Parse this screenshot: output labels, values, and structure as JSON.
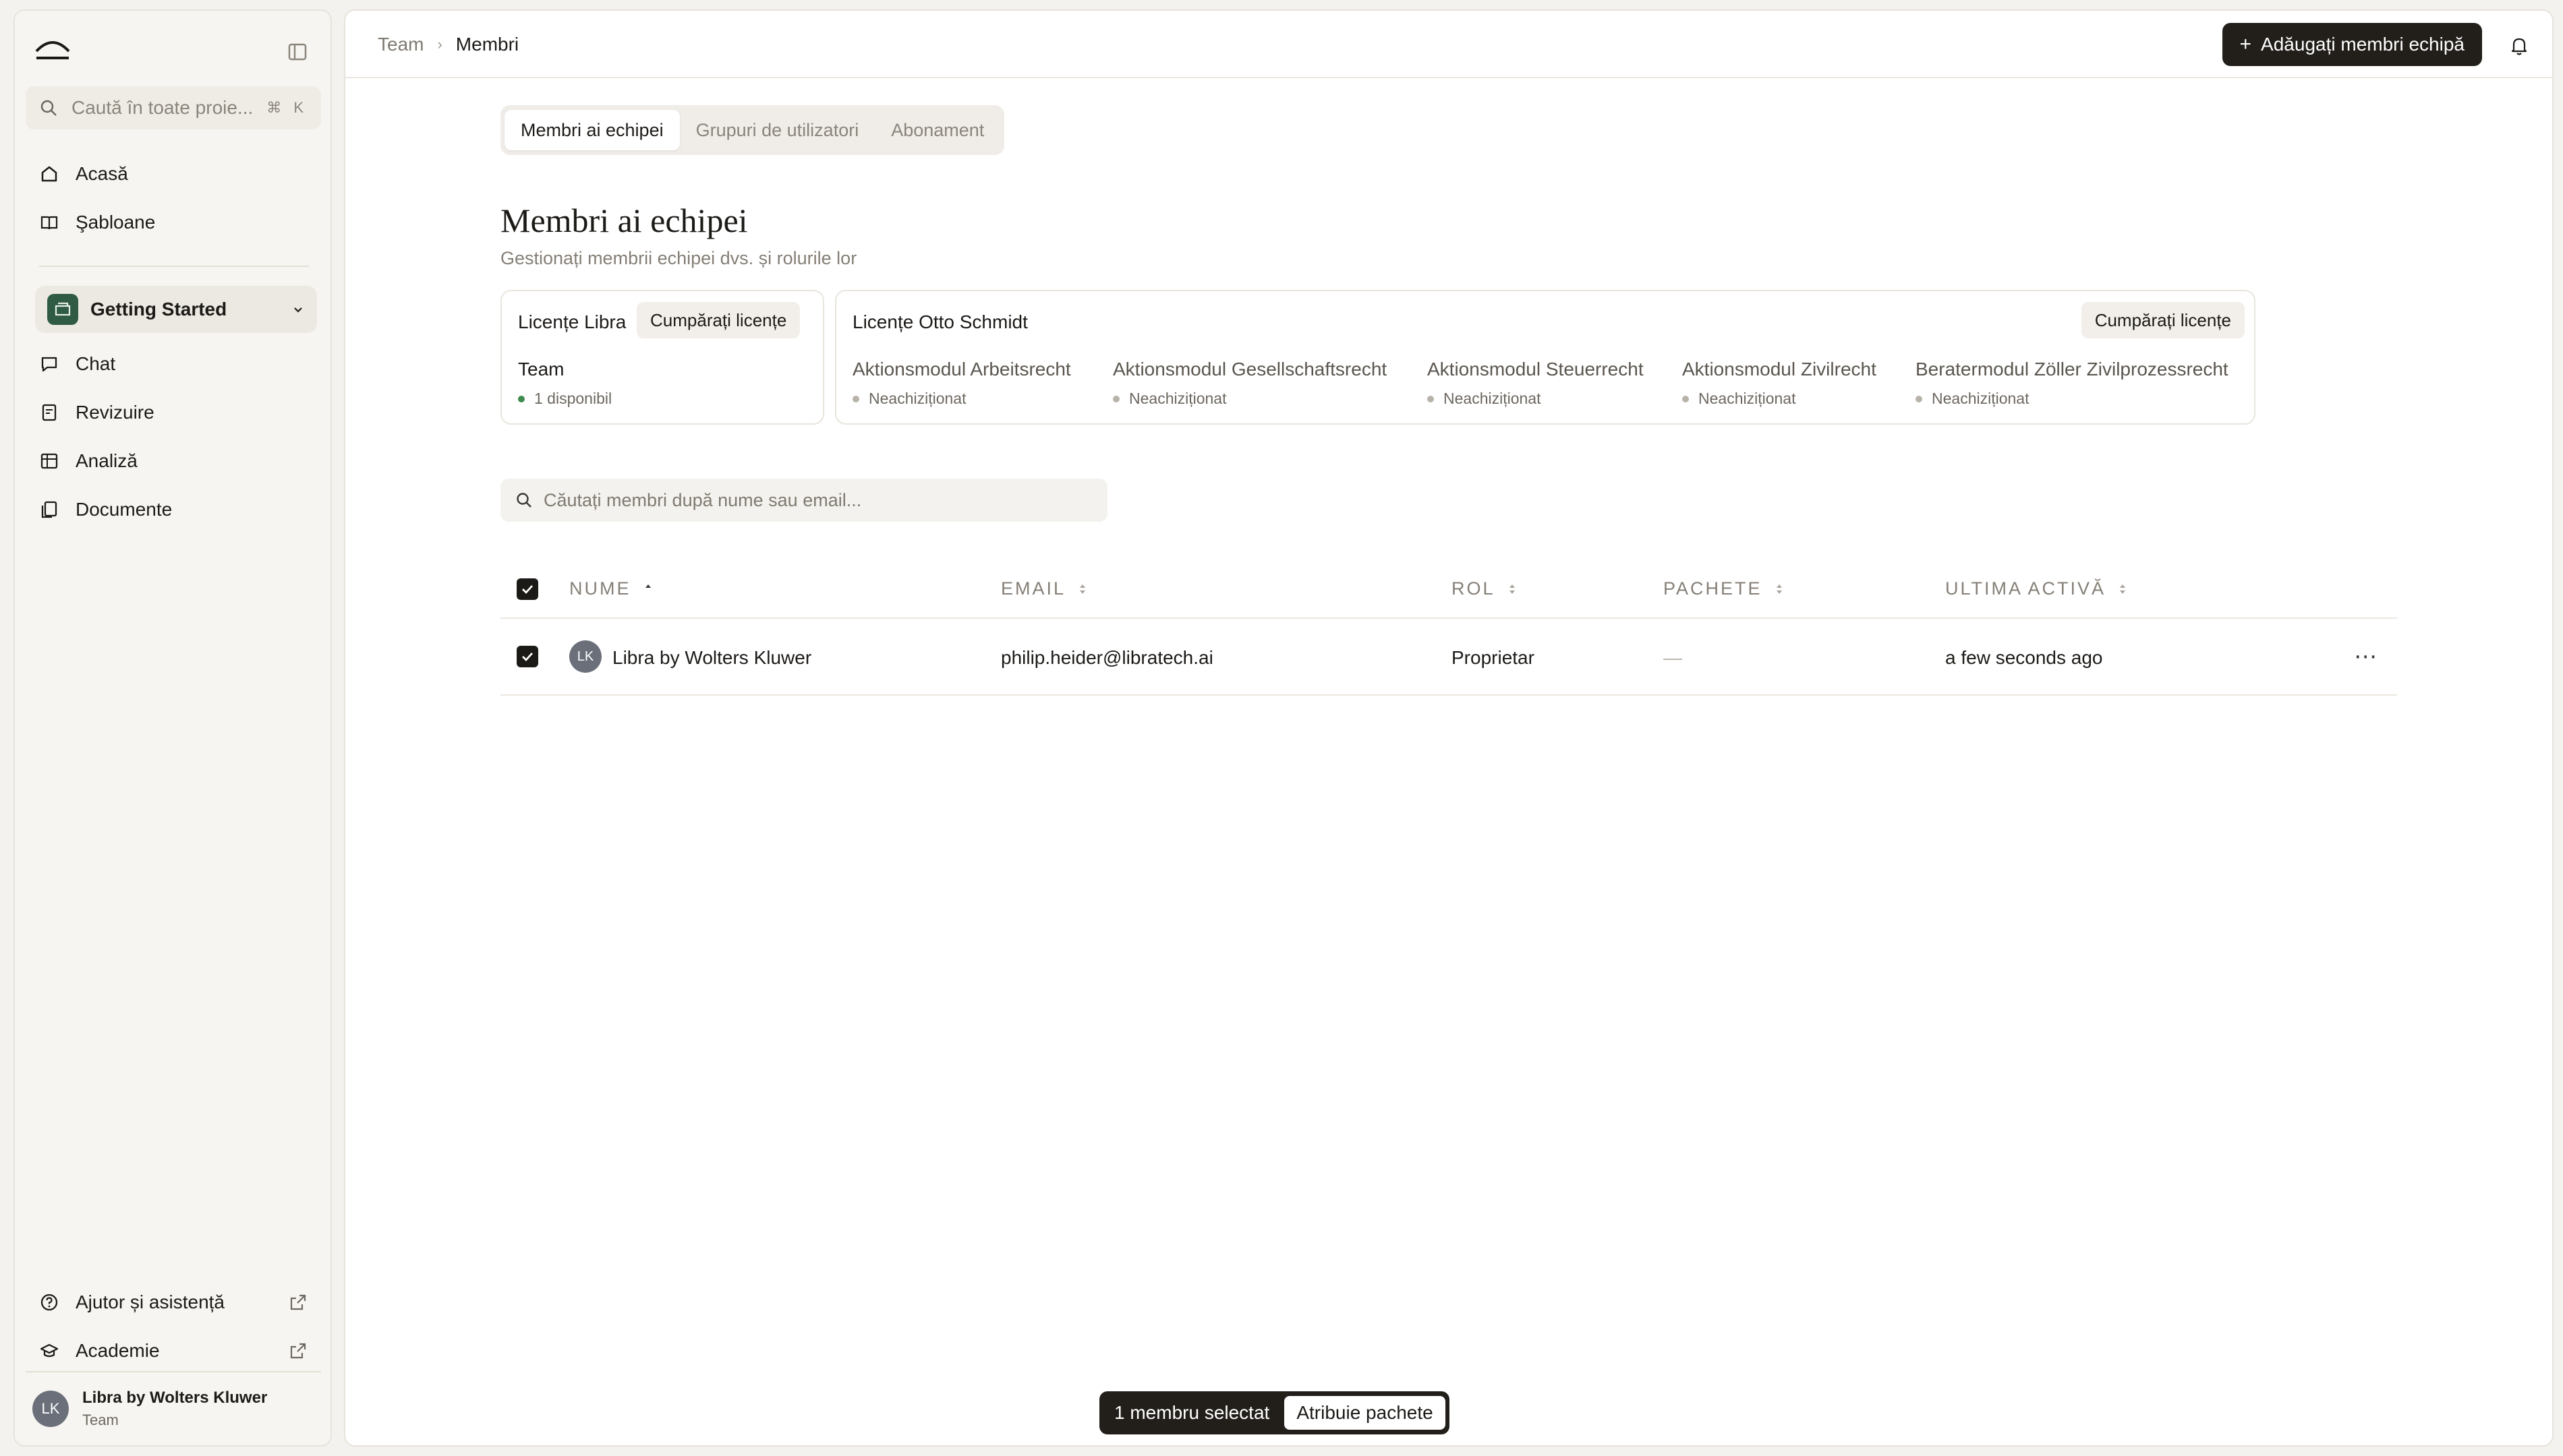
{
  "sidebar": {
    "search_placeholder": "Caută în toate proie...",
    "search_shortcut": "⌘ K",
    "items": [
      {
        "label": "Acasă",
        "icon": "home-icon"
      },
      {
        "label": "Şabloane",
        "icon": "book-icon"
      }
    ],
    "project": {
      "label": "Getting Started",
      "icon": "folder-icon"
    },
    "project_items": [
      {
        "label": "Chat",
        "icon": "chat-icon"
      },
      {
        "label": "Revizuire",
        "icon": "review-icon"
      },
      {
        "label": "Analiză",
        "icon": "table-icon"
      },
      {
        "label": "Documente",
        "icon": "documents-icon"
      }
    ],
    "footer_items": [
      {
        "label": "Ajutor și asistență",
        "icon": "help-icon"
      },
      {
        "label": "Academie",
        "icon": "graduation-cap-icon"
      }
    ],
    "user": {
      "initials": "LK",
      "name": "Libra by Wolters Kluwer",
      "role": "Team"
    }
  },
  "header": {
    "breadcrumb": [
      "Team",
      "Membri"
    ],
    "add_button": "Adăugați membri echipă"
  },
  "tabs": [
    "Membri ai echipei",
    "Grupuri de utilizatori",
    "Abonament"
  ],
  "page": {
    "title": "Membri ai echipei",
    "subtitle": "Gestionați membrii echipei dvs. și rolurile lor"
  },
  "licenses": {
    "libra": {
      "title": "Licențe Libra",
      "buy": "Cumpărați licențe",
      "plan": "Team",
      "status": "1 disponibil"
    },
    "otto": {
      "title": "Licențe Otto Schmidt",
      "buy": "Cumpărați licențe",
      "packages": [
        {
          "name": "Aktionsmodul Arbeitsrecht",
          "status": "Neachiziționat"
        },
        {
          "name": "Aktionsmodul Gesellschaftsrecht",
          "status": "Neachiziționat"
        },
        {
          "name": "Aktionsmodul Steuerrecht",
          "status": "Neachiziționat"
        },
        {
          "name": "Aktionsmodul Zivilrecht",
          "status": "Neachiziționat"
        },
        {
          "name": "Beratermodul Zöller Zivilprozessrecht",
          "status": "Neachiziționat"
        }
      ]
    }
  },
  "member_search_placeholder": "Căutați membri după nume sau email...",
  "table": {
    "columns": [
      "NUME",
      "EMAIL",
      "ROL",
      "PACHETE",
      "ULTIMA ACTIVĂ"
    ],
    "rows": [
      {
        "initials": "LK",
        "name": "Libra by Wolters Kluwer",
        "email": "philip.heider@libratech.ai",
        "role": "Proprietar",
        "packages": "—",
        "last_active": "a few seconds ago"
      }
    ]
  },
  "selection": {
    "count_label": "1 membru selectat",
    "assign_label": "Atribuie pachete"
  },
  "colors": {
    "accent_dark": "#221f1b",
    "project_badge": "#2f5a43",
    "available_dot": "#3d8b4e"
  }
}
